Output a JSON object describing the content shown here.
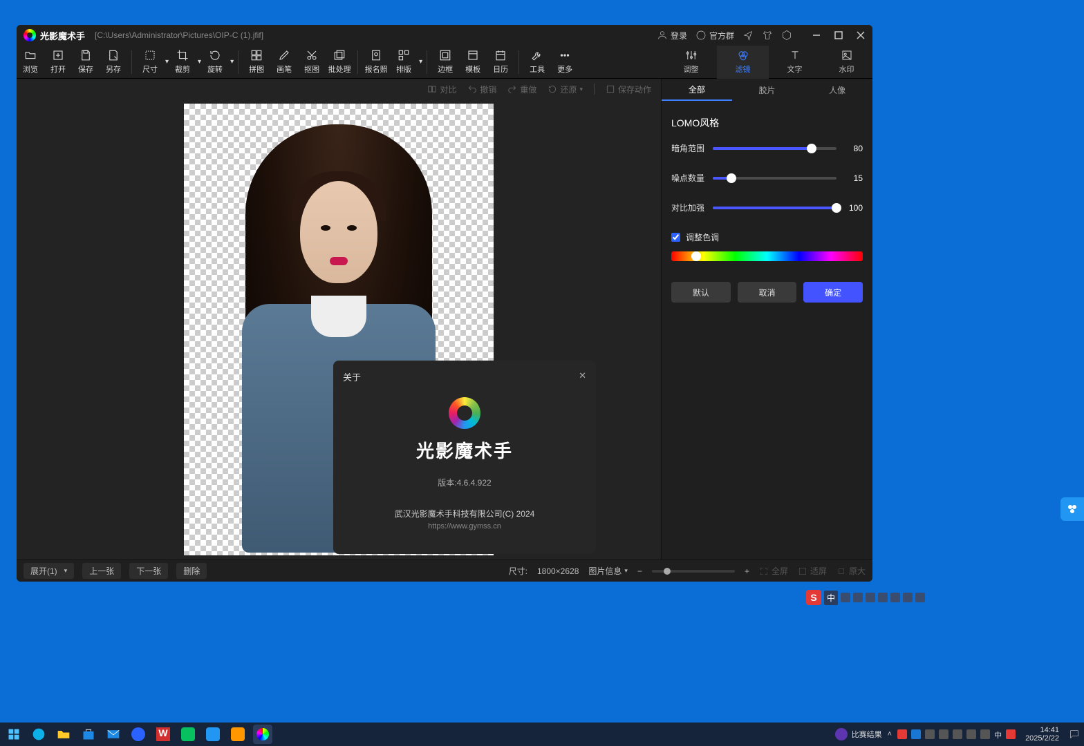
{
  "titlebar": {
    "app_name": "光影魔术手",
    "file_path": "[C:\\Users\\Administrator\\Pictures\\OIP-C (1).jfif]",
    "login": "登录",
    "group": "官方群"
  },
  "toolbar": {
    "browse": "浏览",
    "open": "打开",
    "save": "保存",
    "saveas": "另存",
    "size": "尺寸",
    "crop": "裁剪",
    "rotate": "旋转",
    "collage": "拼图",
    "pen": "画笔",
    "cutout": "抠图",
    "batch": "批处理",
    "idphoto": "报名照",
    "layout": "排版",
    "border": "边框",
    "template": "模板",
    "calendar": "日历",
    "tools": "工具",
    "more": "更多"
  },
  "right_tabs": {
    "adjust": "调整",
    "filter": "滤镜",
    "text": "文字",
    "watermark": "水印"
  },
  "canvas_top": {
    "compare": "对比",
    "undo": "撤销",
    "redo": "重做",
    "reset": "还原",
    "save_action": "保存动作"
  },
  "panel": {
    "tabs": {
      "all": "全部",
      "film": "胶片",
      "portrait": "人像"
    },
    "title": "LOMO风格",
    "vignette_label": "暗角范围",
    "vignette_val": "80",
    "vignette_pct": 80,
    "noise_label": "噪点数量",
    "noise_val": "15",
    "noise_pct": 15,
    "contrast_label": "对比加强",
    "contrast_val": "100",
    "contrast_pct": 100,
    "hue_chk": "调整色调",
    "hue_pct": 13,
    "btn_default": "默认",
    "btn_cancel": "取消",
    "btn_ok": "确定"
  },
  "statusbar": {
    "expand": "展开(1)",
    "prev": "上一张",
    "next": "下一张",
    "delete": "删除",
    "dim_label": "尺寸:",
    "dim_val": "1800×2628",
    "info": "图片信息",
    "fullscreen": "全屏",
    "fit": "适屏",
    "orig": "原大"
  },
  "about": {
    "title": "关于",
    "app": "光影魔术手",
    "version": "版本:4.6.4.922",
    "company": "武汉光影魔术手科技有限公司(C) 2024",
    "url": "https://www.gymss.cn"
  },
  "taskbar": {
    "match": "比赛结果",
    "time": "14:41",
    "date": "2025/2/22",
    "ime": "中"
  }
}
